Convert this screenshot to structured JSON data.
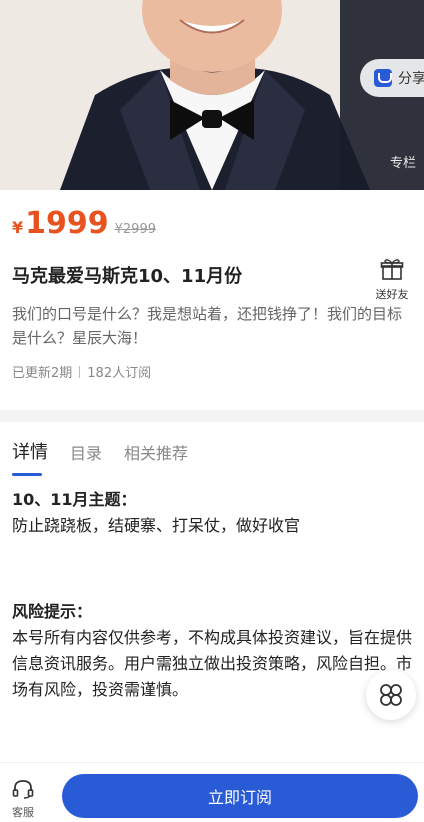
{
  "hero": {
    "share_label": "分享",
    "column_tag": "专栏"
  },
  "product": {
    "currency": "¥",
    "price": "1999",
    "original_price": "¥2999",
    "title": "马克最爱马斯克10、11月份",
    "gift_label": "送好友",
    "description": "我们的口号是什么？我是想站着，还把钱挣了！我们的目标是什么？星辰大海！",
    "updated": "已更新2期",
    "subscribers": "182人订阅"
  },
  "tabs": [
    {
      "label": "详情",
      "active": true
    },
    {
      "label": "目录",
      "active": false
    },
    {
      "label": "相关推荐",
      "active": false
    }
  ],
  "content": {
    "theme_heading": "10、11月主题：",
    "theme_text": "防止跷跷板，结硬寨、打呆仗，做好收官",
    "risk_heading": "风险提示：",
    "risk_text": "本号所有内容仅供参考，不构成具体投资建议，旨在提供信息资讯服务。用户需独立做出投资策略，风险自担。市场有风险，投资需谨慎。"
  },
  "bottom": {
    "service_label": "客服",
    "subscribe_label": "立即订阅"
  },
  "colors": {
    "accent": "#2a5bd7",
    "price": "#e8521f"
  }
}
